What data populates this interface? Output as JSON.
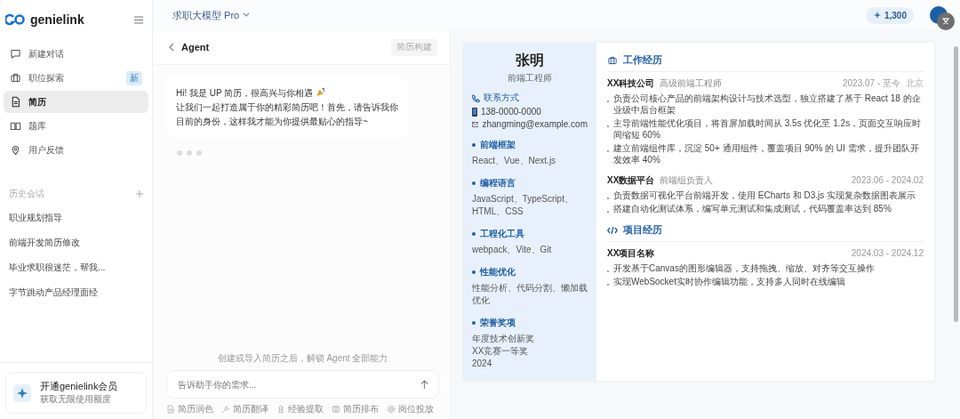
{
  "sidebar": {
    "logo": "genielink",
    "nav": [
      {
        "label": "新建对话",
        "selected": false
      },
      {
        "label": "职位探索",
        "badge": "新",
        "selected": false
      },
      {
        "label": "简历",
        "selected": true
      },
      {
        "label": "题库",
        "selected": false
      },
      {
        "label": "用户反馈",
        "selected": false
      }
    ],
    "history_title": "历史会话",
    "history": [
      "职业规划指导",
      "前端开发简历修改",
      "毕业求职很迷茫，帮我...",
      "字节跳动产品经理面经"
    ],
    "membership": {
      "title": "开通genielink会员",
      "subtitle": "获取无限使用额度"
    }
  },
  "topbar": {
    "model": "求职大模型 Pro",
    "credits": "1,300"
  },
  "agent": {
    "title": "Agent",
    "tag": "简历构建",
    "message": [
      "Hi! 我是 UP 简历，很高兴与你相遇",
      "让我们一起打造属于你的精彩简历吧！首先，请告诉我你目前的身份，这样我才能为你提供最贴心的指导~"
    ],
    "hint": "创建或导入简历之后，解锁 Agent 全部能力",
    "placeholder": "告诉助手你的需求...",
    "tools": [
      "简历润色",
      "简历翻译",
      "经验提取",
      "简历排布",
      "岗位投放"
    ]
  },
  "resume": {
    "name": "张明",
    "title": "前端工程师",
    "contact_heading": "联系方式",
    "phone": "138-0000-0000",
    "email": "zhangming@example.com",
    "skills": [
      {
        "heading": "前端框架",
        "lines": [
          "React、Vue、Next.js"
        ]
      },
      {
        "heading": "编程语言",
        "lines": [
          "JavaScript、TypeScript、HTML、CSS"
        ]
      },
      {
        "heading": "工程化工具",
        "lines": [
          "webpack、Vite、Git"
        ]
      },
      {
        "heading": "性能优化",
        "lines": [
          "性能分析、代码分割、懒加载优化"
        ]
      },
      {
        "heading": "荣誉奖项",
        "lines": [
          "年度技术创新奖",
          "XX竞赛一等奖",
          "2024"
        ]
      }
    ],
    "work_heading": "工作经历",
    "jobs": [
      {
        "company": "XX科技公司",
        "role": "高级前端工程师",
        "period": "2023.07 - 至今",
        "location": "北京",
        "bullets": [
          "负责公司核心产品的前端架构设计与技术选型，独立搭建了基于 React 18 的企业级中后台框架",
          "主导前端性能优化项目，将首屏加载时间从 3.5s 优化至 1.2s，页面交互响应时间缩短 60%",
          "建立前端组件库，沉淀 50+ 通用组件，覆盖项目 90% 的 UI 需求，提升团队开发效率 40%"
        ]
      },
      {
        "company": "XX数据平台",
        "role": "前端组负责人",
        "period": "2023.06 - 2024.02",
        "bullets": [
          "负责数据可视化平台前端开发，使用 ECharts 和 D3.js 实现复杂数据图表展示",
          "搭建自动化测试体系，编写单元测试和集成测试，代码覆盖率达到 85%"
        ]
      }
    ],
    "project_heading": "项目经历",
    "projects": [
      {
        "name": "XX项目名称",
        "period": "2024.03 - 2024.12",
        "bullets": [
          "开发基于Canvas的图形编辑器，支持拖拽、缩放、对齐等交互操作",
          "实现WebSocket实时协作编辑功能，支持多人同时在线编辑"
        ]
      }
    ]
  }
}
